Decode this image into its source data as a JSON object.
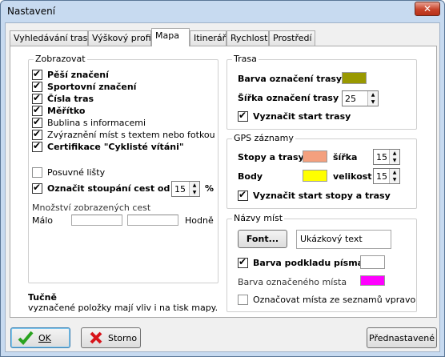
{
  "window": {
    "title": "Nastavení",
    "close_label": "✕"
  },
  "tabs": [
    {
      "label": "Vyhledávání trasy"
    },
    {
      "label": "Výškový profil"
    },
    {
      "label": "Mapa"
    },
    {
      "label": "Itinerář"
    },
    {
      "label": "Rychlost"
    },
    {
      "label": "Prostředí"
    }
  ],
  "active_tab": "Mapa",
  "display_group": {
    "legend": "Zobrazovat",
    "items": [
      {
        "label": "Pěší značení",
        "checked": true,
        "bold": true
      },
      {
        "label": "Sportovní značení",
        "checked": true,
        "bold": true
      },
      {
        "label": "Čísla tras",
        "checked": true,
        "bold": true
      },
      {
        "label": "Měřítko",
        "checked": true,
        "bold": true
      },
      {
        "label": "Bublina s informacemi",
        "checked": true,
        "bold": false
      },
      {
        "label": "Zvýraznění míst s textem nebo fotkou",
        "checked": true,
        "bold": false
      },
      {
        "label": "Certifikace \"Cyklisté vítáni\"",
        "checked": true,
        "bold": true
      }
    ],
    "scroll_bars": {
      "label": "Posuvné lišty",
      "checked": false
    },
    "climb": {
      "label": "Označit stoupání cest od",
      "checked": true,
      "value": "15",
      "unit": "%"
    },
    "quantity": {
      "label": "Množství zobrazených cest",
      "low": "Málo",
      "high": "Hodně"
    }
  },
  "route_group": {
    "legend": "Trasa",
    "color_label": "Barva označení trasy",
    "color": "#999900",
    "width_label": "Šířka označení trasy",
    "width_value": "25",
    "start": {
      "label": "Vyznačit start trasy",
      "checked": true
    }
  },
  "gps_group": {
    "legend": "GPS záznamy",
    "tracks_label": "Stopy a trasy",
    "tracks_color": "#f4a07e",
    "tracks_width_label": "šířka",
    "tracks_width_value": "15",
    "points_label": "Body",
    "points_color": "#ffff00",
    "points_size_label": "velikost",
    "points_size_value": "15",
    "start": {
      "label": "Vyznačit start stopy a trasy",
      "checked": true
    }
  },
  "places_group": {
    "legend": "Názvy míst",
    "font_button": "Font...",
    "sample_text": "Ukázkový text",
    "bg_color": {
      "label": "Barva podkladu písma",
      "checked": true,
      "color": "#ffffff"
    },
    "place_color_label": "Barva označeného místa",
    "place_color": "#ff00ff",
    "from_list": {
      "label": "Označovat místa ze seznamů vpravo",
      "checked": false
    }
  },
  "footnote": {
    "title": "Tučně",
    "text": "vyznačené položky mají vliv i na tisk mapy."
  },
  "buttons": {
    "ok": "OK",
    "cancel": "Storno",
    "defaults": "Přednastavené"
  }
}
